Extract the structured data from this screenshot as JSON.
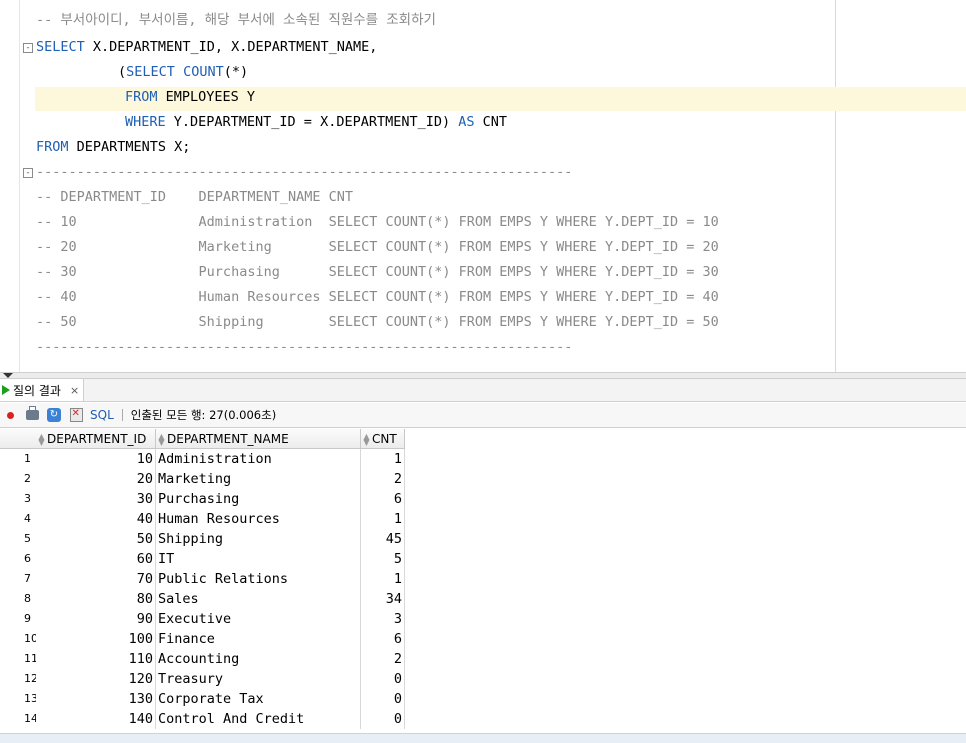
{
  "editor": {
    "lines": {
      "l1": "-- 부서아이디, 부서이름, 해당 부서에 소속된 직원수를 조회하기",
      "l2_kw": "SELECT",
      "l2_rest": " X.DEPARTMENT_ID, X.DEPARTMENT_NAME,",
      "l3_paren": "(",
      "l3_kw1": "SELECT",
      "l3_sp": " ",
      "l3_kw2": "COUNT",
      "l3_rest": "(*)",
      "l4_kw": "FROM",
      "l4_rest": " EMPLOYEES Y",
      "l5_kw": "WHERE",
      "l5_rest": " Y.DEPARTMENT_ID = X.DEPARTMENT_ID) ",
      "l5_kw2": "AS",
      "l5_rest2": " CNT",
      "l6_kw": "FROM",
      "l6_rest": " DEPARTMENTS X;",
      "sep1": "------------------------------------------------------------------",
      "c_head": "-- DEPARTMENT_ID    DEPARTMENT_NAME CNT",
      "c1": "-- 10               Administration  SELECT COUNT(*) FROM EMPS Y WHERE Y.DEPT_ID = 10",
      "c2": "-- 20               Marketing       SELECT COUNT(*) FROM EMPS Y WHERE Y.DEPT_ID = 20",
      "c3": "-- 30               Purchasing      SELECT COUNT(*) FROM EMPS Y WHERE Y.DEPT_ID = 30",
      "c4": "-- 40               Human Resources SELECT COUNT(*) FROM EMPS Y WHERE Y.DEPT_ID = 40",
      "c5": "-- 50               Shipping        SELECT COUNT(*) FROM EMPS Y WHERE Y.DEPT_ID = 50",
      "sep2": "------------------------------------------------------------------"
    },
    "fold_glyph": "⊟"
  },
  "results_tab": {
    "label": "질의 결과",
    "close": "×"
  },
  "toolbar": {
    "sql_label": "SQL",
    "status": "인출된 모든 행: 27(0.006초)"
  },
  "grid": {
    "columns": [
      "DEPARTMENT_ID",
      "DEPARTMENT_NAME",
      "CNT"
    ],
    "rows": [
      {
        "n": "1",
        "id": "10",
        "name": "Administration",
        "cnt": "1"
      },
      {
        "n": "2",
        "id": "20",
        "name": "Marketing",
        "cnt": "2"
      },
      {
        "n": "3",
        "id": "30",
        "name": "Purchasing",
        "cnt": "6"
      },
      {
        "n": "4",
        "id": "40",
        "name": "Human Resources",
        "cnt": "1"
      },
      {
        "n": "5",
        "id": "50",
        "name": "Shipping",
        "cnt": "45"
      },
      {
        "n": "6",
        "id": "60",
        "name": "IT",
        "cnt": "5"
      },
      {
        "n": "7",
        "id": "70",
        "name": "Public Relations",
        "cnt": "1"
      },
      {
        "n": "8",
        "id": "80",
        "name": "Sales",
        "cnt": "34"
      },
      {
        "n": "9",
        "id": "90",
        "name": "Executive",
        "cnt": "3"
      },
      {
        "n": "10",
        "id": "100",
        "name": "Finance",
        "cnt": "6"
      },
      {
        "n": "11",
        "id": "110",
        "name": "Accounting",
        "cnt": "2"
      },
      {
        "n": "12",
        "id": "120",
        "name": "Treasury",
        "cnt": "0"
      },
      {
        "n": "13",
        "id": "130",
        "name": "Corporate Tax",
        "cnt": "0"
      },
      {
        "n": "14",
        "id": "140",
        "name": "Control And Credit",
        "cnt": "0"
      }
    ]
  },
  "icons": {
    "pin": "pin-icon",
    "print": "print-icon",
    "refresh": "refresh-icon",
    "export": "export-icon",
    "run": "run-query-icon"
  },
  "colors": {
    "keyword": "#1f5fb4",
    "comment": "#8a8a8a",
    "current_line": "#fdf8dc",
    "run_green": "#1aa01a"
  }
}
